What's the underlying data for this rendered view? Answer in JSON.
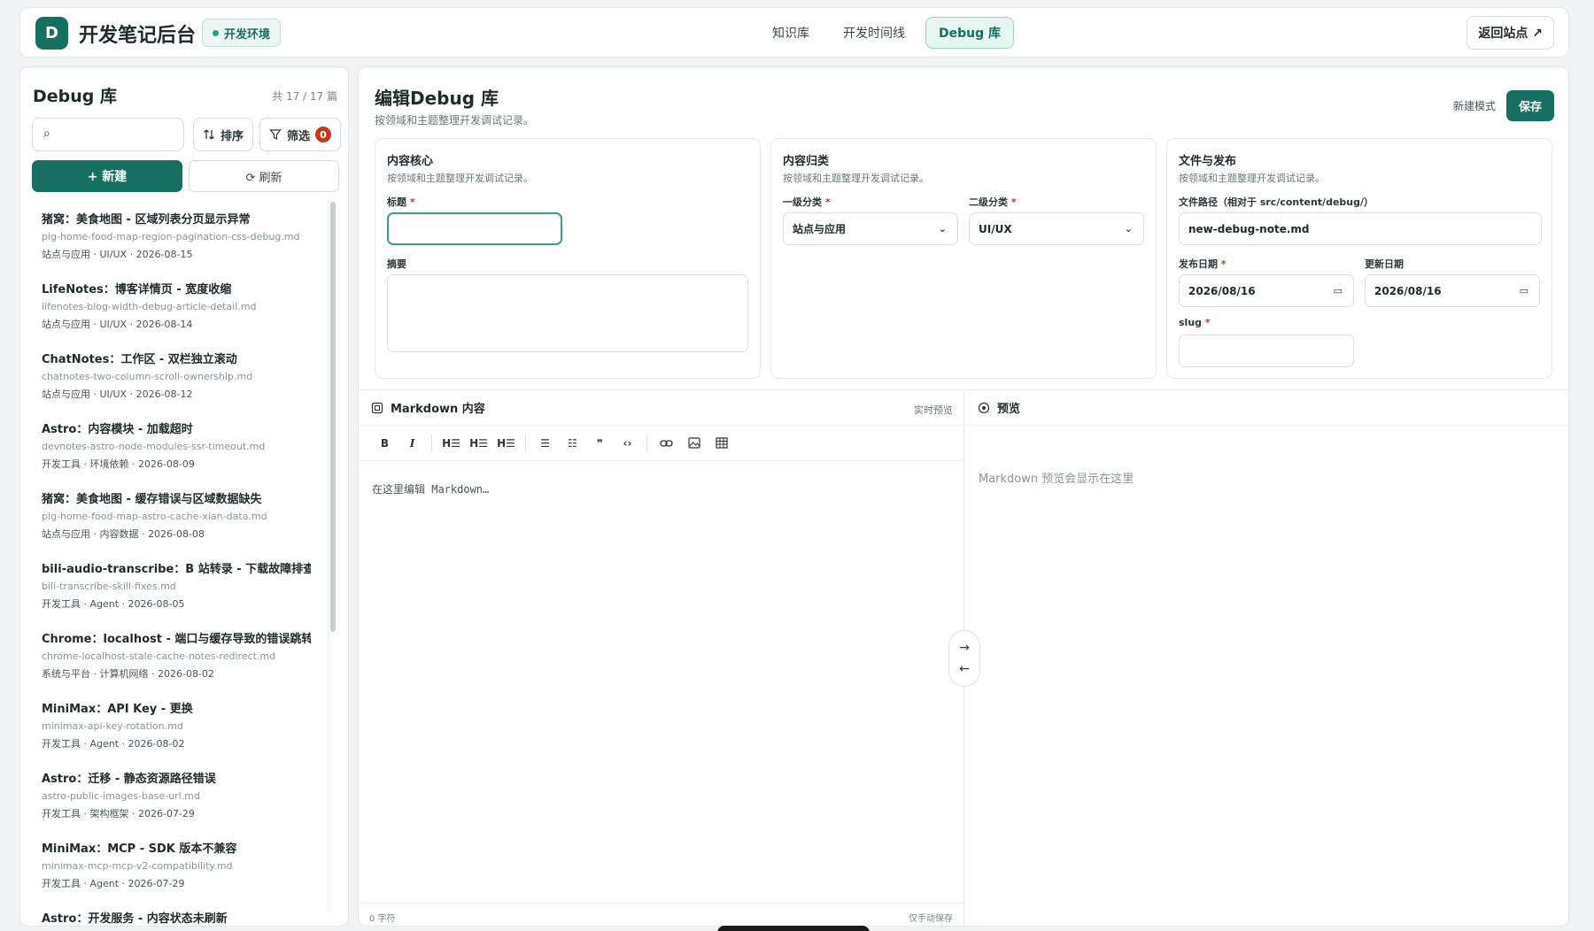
{
  "header": {
    "logo_letter": "D",
    "app_title": "开发笔记后台",
    "env_badge": "开发环境",
    "tabs": [
      {
        "label": "知识库"
      },
      {
        "label": "开发时间线"
      },
      {
        "label": "Debug 库"
      }
    ],
    "back_label": "返回站点 ↗"
  },
  "sidebar": {
    "title": "Debug 库",
    "count": "共 17 / 17 篇",
    "search_value": "",
    "sort_label": "排序",
    "filter_label": "筛选",
    "filter_badge": "0",
    "new_label": "+ 新建",
    "refresh_label": "⟳ 刷新",
    "items": [
      {
        "title": "猪窝：美食地图 - 区域列表分页显示异常",
        "file": "pig-home-food-map-region-pagination-css-debug.md",
        "meta": "站点与应用 · UI/UX · 2026-08-15"
      },
      {
        "title": "LifeNotes：博客详情页 - 宽度收缩",
        "file": "lifenotes-blog-width-debug-article-detail.md",
        "meta": "站点与应用 · UI/UX · 2026-08-14"
      },
      {
        "title": "ChatNotes：工作区 - 双栏独立滚动",
        "file": "chatnotes-two-column-scroll-ownership.md",
        "meta": "站点与应用 · UI/UX · 2026-08-12"
      },
      {
        "title": "Astro：内容模块 - 加载超时",
        "file": "devnotes-astro-node-modules-ssr-timeout.md",
        "meta": "开发工具 · 环境依赖 · 2026-08-09"
      },
      {
        "title": "猪窝：美食地图 - 缓存错误与区域数据缺失",
        "file": "pig-home-food-map-astro-cache-xian-data.md",
        "meta": "站点与应用 · 内容数据 · 2026-08-08"
      },
      {
        "title": "bili-audio-transcribe：B 站转录 - 下载故障排查",
        "file": "bili-transcribe-skill-fixes.md",
        "meta": "开发工具 · Agent · 2026-08-05"
      },
      {
        "title": "Chrome：localhost - 端口与缓存导致的错误跳转",
        "file": "chrome-localhost-stale-cache-notes-redirect.md",
        "meta": "系统与平台 · 计算机网络 · 2026-08-02"
      },
      {
        "title": "MiniMax：API Key - 更换",
        "file": "minimax-api-key-rotation.md",
        "meta": "开发工具 · Agent · 2026-08-02"
      },
      {
        "title": "Astro：迁移 - 静态资源路径错误",
        "file": "astro-public-images-base-url.md",
        "meta": "开发工具 · 架构框架 · 2026-07-29"
      },
      {
        "title": "MiniMax：MCP - SDK 版本不兼容",
        "file": "minimax-mcp-mcp-v2-compatibility.md",
        "meta": "开发工具 · Agent · 2026-07-29"
      },
      {
        "title": "Astro：开发服务 - 内容状态未刷新",
        "file": "",
        "meta": ""
      }
    ]
  },
  "main": {
    "title": "编辑Debug 库",
    "subtitle": "按领域和主题整理开发调试记录。",
    "mode_label": "新建模式",
    "save_label": "保存",
    "card_core": {
      "title": "内容核心",
      "subtitle": "按领域和主题整理开发调试记录。",
      "title_label": "标题",
      "title_value": "",
      "summary_label": "摘要",
      "summary_value": ""
    },
    "card_category": {
      "title": "内容归类",
      "subtitle": "按领域和主题整理开发调试记录。",
      "primary_label": "一级分类",
      "primary_value": "站点与应用",
      "secondary_label": "二级分类",
      "secondary_value": "UI/UX"
    },
    "card_file": {
      "title": "文件与发布",
      "subtitle": "按领域和主题整理开发调试记录。",
      "path_label": "文件路径（相对于 src/content/debug/）",
      "path_value": "new-debug-note.md",
      "publish_label": "发布日期",
      "publish_value": "2026/08/16",
      "update_label": "更新日期",
      "update_value": "2026/08/16",
      "slug_label": "slug",
      "slug_value": ""
    },
    "editor": {
      "title": "Markdown 内容",
      "live_label": "实时预览",
      "placeholder": "在这里编辑 Markdown…",
      "chars": "0 字符",
      "save_note": "仅手动保存",
      "toolbar": [
        "B",
        "I",
        "H1",
        "H2",
        "H3",
        "ul",
        "ol",
        "quote",
        "code",
        "link",
        "image",
        "table"
      ]
    },
    "preview": {
      "title": "预览",
      "placeholder": "Markdown 预览会显示在这里"
    }
  },
  "required_mark": "*"
}
